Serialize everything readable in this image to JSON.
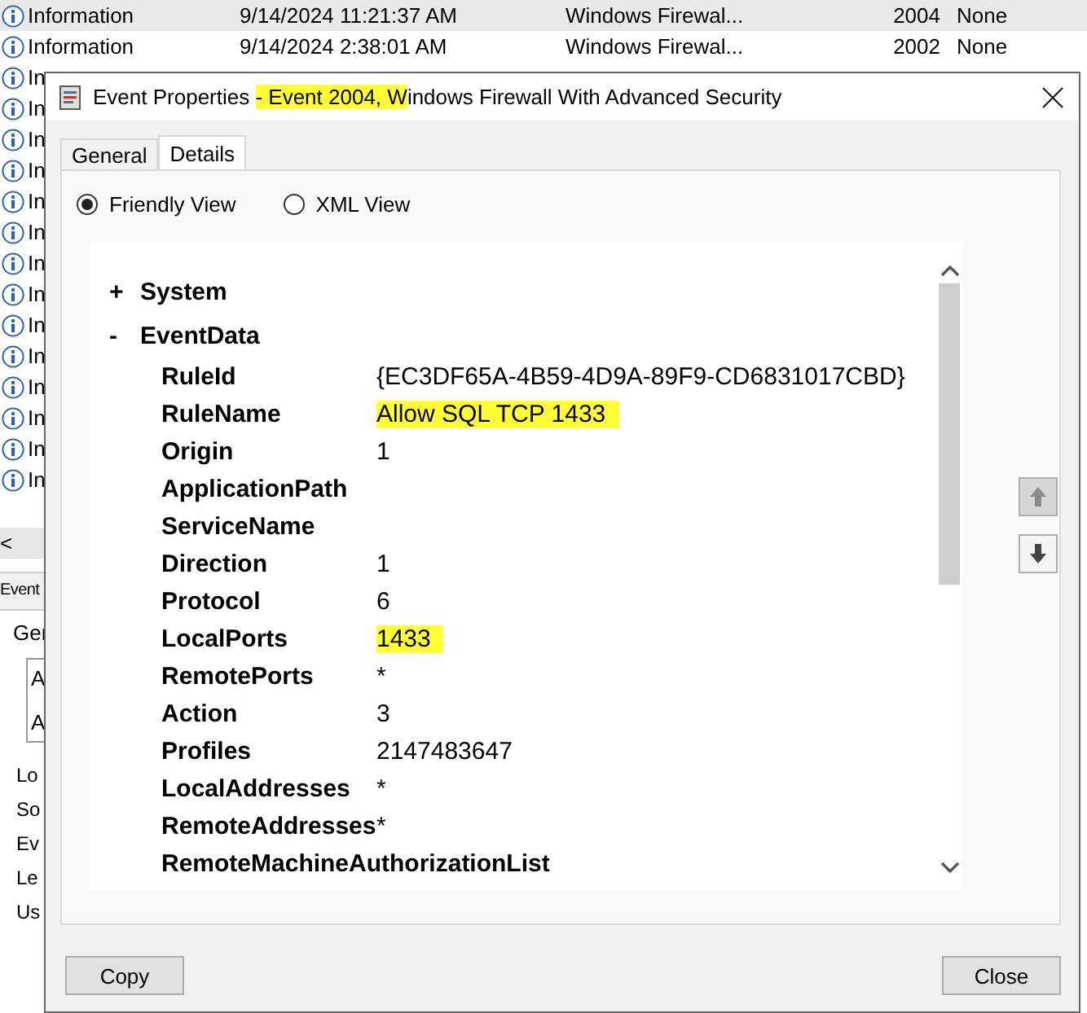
{
  "event_list": {
    "rows": [
      {
        "level": "Information",
        "date": "9/14/2024 11:21:37 AM",
        "source": "Windows Firewal...",
        "event_id": "2004",
        "category": "None",
        "selected": true
      },
      {
        "level": "Information",
        "date": "9/14/2024 2:38:01 AM",
        "source": "Windows Firewal...",
        "event_id": "2002",
        "category": "None",
        "selected": false
      }
    ],
    "partial_rows": [
      "In",
      "In",
      "In",
      "In",
      "In",
      "In",
      "In",
      "In",
      "In",
      "In",
      "In",
      "In",
      "In",
      "In"
    ],
    "scroll_left": "<"
  },
  "preview_pane": {
    "header": "Event",
    "tab": "Ger",
    "boxed_lines": [
      "A",
      "A"
    ],
    "labels": [
      "Lo",
      "So",
      "Ev",
      "Le",
      "Us"
    ]
  },
  "dialog": {
    "title": [
      {
        "text": "Event Properties ",
        "highlighted": false
      },
      {
        "text": "- Event 2004, W",
        "highlighted": true
      },
      {
        "text": "indows Firewall With Advanced Security",
        "highlighted": false
      }
    ],
    "tabs": [
      {
        "label": "General",
        "selected": false
      },
      {
        "label": "Details",
        "selected": true
      }
    ],
    "views": [
      {
        "label": "Friendly View",
        "selected": true
      },
      {
        "label": "XML View",
        "selected": false
      }
    ],
    "tree": [
      {
        "toggle": "+",
        "label": "System"
      },
      {
        "toggle": "-",
        "label": "EventData",
        "children": [
          {
            "name": "RuleId",
            "value": "{EC3DF65A-4B59-4D9A-89F9-CD6831017CBD}"
          },
          {
            "name": "RuleName",
            "value": "Allow SQL TCP 1433",
            "highlighted": true
          },
          {
            "name": "Origin",
            "value": "1"
          },
          {
            "name": "ApplicationPath"
          },
          {
            "name": "ServiceName"
          },
          {
            "name": "Direction",
            "value": "1"
          },
          {
            "name": "Protocol",
            "value": "6"
          },
          {
            "name": "LocalPorts",
            "value": "1433",
            "highlighted": true
          },
          {
            "name": "RemotePorts",
            "value": "*"
          },
          {
            "name": "Action",
            "value": "3"
          },
          {
            "name": "Profiles",
            "value": "2147483647"
          },
          {
            "name": "LocalAddresses",
            "value": "*"
          },
          {
            "name": "RemoteAddresses",
            "value": "*"
          },
          {
            "name": "RemoteMachineAuthorizationList"
          }
        ]
      }
    ],
    "buttons": [
      "Copy",
      "Close"
    ]
  }
}
